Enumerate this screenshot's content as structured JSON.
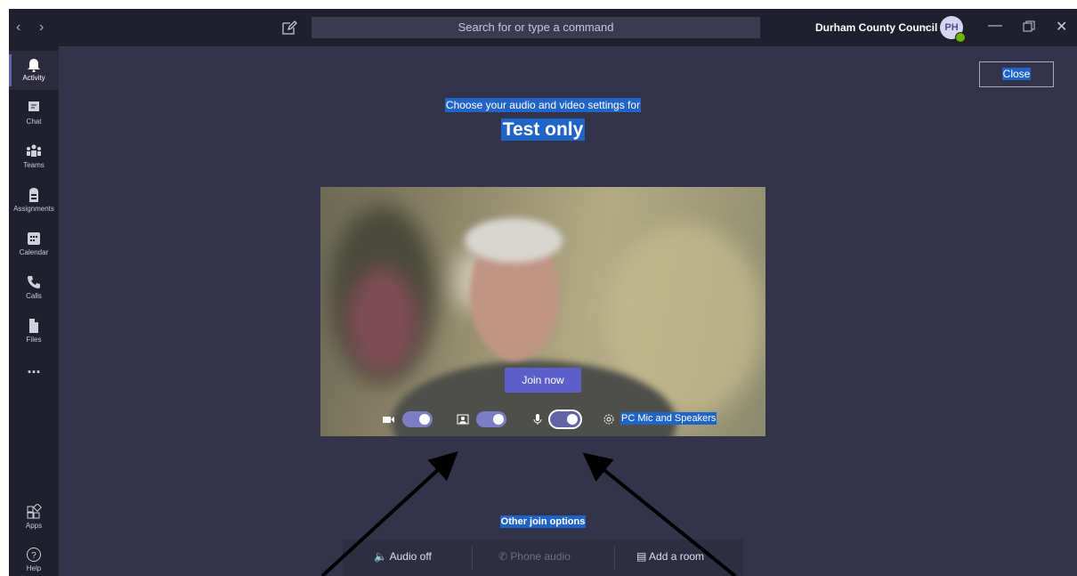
{
  "titlebar": {
    "back_icon": "chevron-left-icon",
    "forward_icon": "chevron-right-icon",
    "search_placeholder": "Search for or type a command",
    "org_name": "Durham County Council",
    "avatar_initials": "PH",
    "presence_color": "#6bb700"
  },
  "rail": {
    "items": [
      {
        "label": "Activity",
        "icon": "bell-icon",
        "active": true
      },
      {
        "label": "Chat",
        "icon": "chat-icon"
      },
      {
        "label": "Teams",
        "icon": "teams-icon"
      },
      {
        "label": "Assignments",
        "icon": "assignments-icon"
      },
      {
        "label": "Calendar",
        "icon": "calendar-icon"
      },
      {
        "label": "Calls",
        "icon": "phone-icon"
      },
      {
        "label": "Files",
        "icon": "file-icon"
      },
      {
        "label": "...",
        "icon": "more-icon"
      }
    ],
    "bottom": [
      {
        "label": "Apps",
        "icon": "apps-icon"
      },
      {
        "label": "Help",
        "icon": "help-icon"
      }
    ]
  },
  "prejoin": {
    "close_label": "Close",
    "subtitle": "Choose your audio and video settings for",
    "meeting_title": "Test only",
    "join_label": "Join now",
    "camera_on": true,
    "blur_on": true,
    "mic_on": true,
    "device_label": "PC Mic and Speakers",
    "other_options_label": "Other join options",
    "options": [
      {
        "label": "Audio off",
        "icon": "speaker-off-icon"
      },
      {
        "label": "Phone audio",
        "icon": "phone-icon",
        "disabled": true
      },
      {
        "label": "Add a room",
        "icon": "cast-icon"
      }
    ]
  },
  "colors": {
    "accent": "#6264a7",
    "selection": "#2164c8",
    "background": "#33344a",
    "rail": "#1f1f2e"
  }
}
